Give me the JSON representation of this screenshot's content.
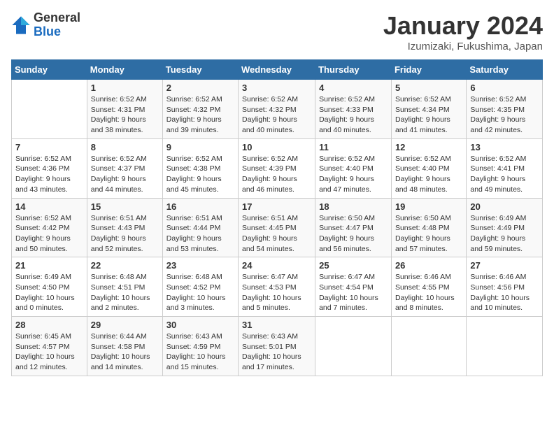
{
  "logo": {
    "general": "General",
    "blue": "Blue"
  },
  "title": "January 2024",
  "location": "Izumizaki, Fukushima, Japan",
  "days_of_week": [
    "Sunday",
    "Monday",
    "Tuesday",
    "Wednesday",
    "Thursday",
    "Friday",
    "Saturday"
  ],
  "weeks": [
    [
      {
        "day": "",
        "info": ""
      },
      {
        "day": "1",
        "info": "Sunrise: 6:52 AM\nSunset: 4:31 PM\nDaylight: 9 hours\nand 38 minutes."
      },
      {
        "day": "2",
        "info": "Sunrise: 6:52 AM\nSunset: 4:32 PM\nDaylight: 9 hours\nand 39 minutes."
      },
      {
        "day": "3",
        "info": "Sunrise: 6:52 AM\nSunset: 4:32 PM\nDaylight: 9 hours\nand 40 minutes."
      },
      {
        "day": "4",
        "info": "Sunrise: 6:52 AM\nSunset: 4:33 PM\nDaylight: 9 hours\nand 40 minutes."
      },
      {
        "day": "5",
        "info": "Sunrise: 6:52 AM\nSunset: 4:34 PM\nDaylight: 9 hours\nand 41 minutes."
      },
      {
        "day": "6",
        "info": "Sunrise: 6:52 AM\nSunset: 4:35 PM\nDaylight: 9 hours\nand 42 minutes."
      }
    ],
    [
      {
        "day": "7",
        "info": "Sunrise: 6:52 AM\nSunset: 4:36 PM\nDaylight: 9 hours\nand 43 minutes."
      },
      {
        "day": "8",
        "info": "Sunrise: 6:52 AM\nSunset: 4:37 PM\nDaylight: 9 hours\nand 44 minutes."
      },
      {
        "day": "9",
        "info": "Sunrise: 6:52 AM\nSunset: 4:38 PM\nDaylight: 9 hours\nand 45 minutes."
      },
      {
        "day": "10",
        "info": "Sunrise: 6:52 AM\nSunset: 4:39 PM\nDaylight: 9 hours\nand 46 minutes."
      },
      {
        "day": "11",
        "info": "Sunrise: 6:52 AM\nSunset: 4:40 PM\nDaylight: 9 hours\nand 47 minutes."
      },
      {
        "day": "12",
        "info": "Sunrise: 6:52 AM\nSunset: 4:40 PM\nDaylight: 9 hours\nand 48 minutes."
      },
      {
        "day": "13",
        "info": "Sunrise: 6:52 AM\nSunset: 4:41 PM\nDaylight: 9 hours\nand 49 minutes."
      }
    ],
    [
      {
        "day": "14",
        "info": "Sunrise: 6:52 AM\nSunset: 4:42 PM\nDaylight: 9 hours\nand 50 minutes."
      },
      {
        "day": "15",
        "info": "Sunrise: 6:51 AM\nSunset: 4:43 PM\nDaylight: 9 hours\nand 52 minutes."
      },
      {
        "day": "16",
        "info": "Sunrise: 6:51 AM\nSunset: 4:44 PM\nDaylight: 9 hours\nand 53 minutes."
      },
      {
        "day": "17",
        "info": "Sunrise: 6:51 AM\nSunset: 4:45 PM\nDaylight: 9 hours\nand 54 minutes."
      },
      {
        "day": "18",
        "info": "Sunrise: 6:50 AM\nSunset: 4:47 PM\nDaylight: 9 hours\nand 56 minutes."
      },
      {
        "day": "19",
        "info": "Sunrise: 6:50 AM\nSunset: 4:48 PM\nDaylight: 9 hours\nand 57 minutes."
      },
      {
        "day": "20",
        "info": "Sunrise: 6:49 AM\nSunset: 4:49 PM\nDaylight: 9 hours\nand 59 minutes."
      }
    ],
    [
      {
        "day": "21",
        "info": "Sunrise: 6:49 AM\nSunset: 4:50 PM\nDaylight: 10 hours\nand 0 minutes."
      },
      {
        "day": "22",
        "info": "Sunrise: 6:48 AM\nSunset: 4:51 PM\nDaylight: 10 hours\nand 2 minutes."
      },
      {
        "day": "23",
        "info": "Sunrise: 6:48 AM\nSunset: 4:52 PM\nDaylight: 10 hours\nand 3 minutes."
      },
      {
        "day": "24",
        "info": "Sunrise: 6:47 AM\nSunset: 4:53 PM\nDaylight: 10 hours\nand 5 minutes."
      },
      {
        "day": "25",
        "info": "Sunrise: 6:47 AM\nSunset: 4:54 PM\nDaylight: 10 hours\nand 7 minutes."
      },
      {
        "day": "26",
        "info": "Sunrise: 6:46 AM\nSunset: 4:55 PM\nDaylight: 10 hours\nand 8 minutes."
      },
      {
        "day": "27",
        "info": "Sunrise: 6:46 AM\nSunset: 4:56 PM\nDaylight: 10 hours\nand 10 minutes."
      }
    ],
    [
      {
        "day": "28",
        "info": "Sunrise: 6:45 AM\nSunset: 4:57 PM\nDaylight: 10 hours\nand 12 minutes."
      },
      {
        "day": "29",
        "info": "Sunrise: 6:44 AM\nSunset: 4:58 PM\nDaylight: 10 hours\nand 14 minutes."
      },
      {
        "day": "30",
        "info": "Sunrise: 6:43 AM\nSunset: 4:59 PM\nDaylight: 10 hours\nand 15 minutes."
      },
      {
        "day": "31",
        "info": "Sunrise: 6:43 AM\nSunset: 5:01 PM\nDaylight: 10 hours\nand 17 minutes."
      },
      {
        "day": "",
        "info": ""
      },
      {
        "day": "",
        "info": ""
      },
      {
        "day": "",
        "info": ""
      }
    ]
  ]
}
